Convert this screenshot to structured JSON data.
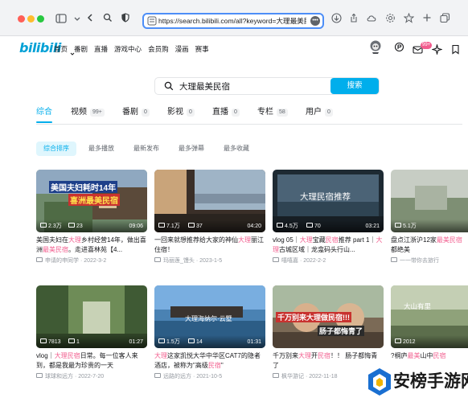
{
  "browser": {
    "url": "https://search.bilibili.com/all?keyword=大理最美民宿"
  },
  "site": {
    "logo": "bilibili",
    "nav": [
      "首页",
      "番剧",
      "直播",
      "游戏中心",
      "会员购",
      "漫画",
      "赛事"
    ],
    "message_badge": "99+"
  },
  "search": {
    "query": "大理最美民宿",
    "button": "搜索"
  },
  "tabs": [
    {
      "label": "综合",
      "count": ""
    },
    {
      "label": "视频",
      "count": "99+"
    },
    {
      "label": "番剧",
      "count": "0"
    },
    {
      "label": "影视",
      "count": "0"
    },
    {
      "label": "直播",
      "count": "0"
    },
    {
      "label": "专栏",
      "count": "58"
    },
    {
      "label": "用户",
      "count": "0"
    }
  ],
  "filters": [
    "综合排序",
    "最多播放",
    "最新发布",
    "最多弹幕",
    "最多收藏"
  ],
  "colors": {
    "accent": "#00aeec",
    "highlight": "#f25d8e",
    "brand": "#00a1d6"
  },
  "videos": [
    {
      "thumb_text": [
        "美国夫妇耗时14年",
        "喜洲最美民宿"
      ],
      "plays": "2.3万",
      "danmaku": "23",
      "duration": "09:06",
      "title": [
        [
          "美国夫妇在",
          ""
        ],
        [
          "大理",
          "hl"
        ],
        [
          "乡村经营14年，做出喜洲",
          ""
        ],
        [
          "最美民宿",
          "hl"
        ],
        [
          "。走进喜林苑【4...",
          ""
        ]
      ],
      "author": "申请的申同学",
      "date": "2022-3-2"
    },
    {
      "thumb_text": [],
      "plays": "7.1万",
      "danmaku": "37",
      "duration": "04:20",
      "title": [
        [
          "一回来就想推荐给大家的神仙",
          ""
        ],
        [
          "大理",
          "hl"
        ],
        [
          "丽江住宿！",
          ""
        ]
      ],
      "author": "玛丽莲_馒头",
      "date": "2023-1-5"
    },
    {
      "thumb_text": [
        "大理民宿推荐"
      ],
      "plays": "4.5万",
      "danmaku": "70",
      "duration": "03:21",
      "title": [
        [
          "vlog 05｜",
          ""
        ],
        [
          "大理",
          "hl"
        ],
        [
          "宝藏",
          ""
        ],
        [
          "民宿",
          "hl"
        ],
        [
          "推荐 part 1｜",
          ""
        ],
        [
          "大理",
          "hl"
        ],
        [
          "古城区域｜龙龛码头行山...",
          ""
        ]
      ],
      "author": "嘻嘻嘉",
      "date": "2022-2-2"
    },
    {
      "thumb_text": [],
      "plays": "5.1万",
      "danmaku": "",
      "duration": "",
      "title": [
        [
          "盘点江浙沪12家",
          ""
        ],
        [
          "最美民宿",
          "hl"
        ],
        [
          "都绝美",
          ""
        ]
      ],
      "author": "一一带你去旅行",
      "date": ""
    },
    {
      "thumb_text": [],
      "plays": "7813",
      "danmaku": "1",
      "duration": "01:27",
      "title": [
        [
          "vlog｜",
          ""
        ],
        [
          "大理",
          "hl"
        ],
        [
          "民宿",
          "hl"
        ],
        [
          "日常。每一位客人来到，都是我最为珍贵的一天",
          ""
        ]
      ],
      "author": "球球和远方",
      "date": "2022-7-20"
    },
    {
      "thumb_text": [
        "大理海纳尔·云墅"
      ],
      "plays": "1.5万",
      "danmaku": "14",
      "duration": "01:31",
      "title": [
        [
          "大理",
          "hl"
        ],
        [
          "这家凯悦大华中华区CAT7的隐者酒店，被称为\"高级",
          ""
        ],
        [
          "民宿",
          "hl"
        ],
        [
          "\"",
          ""
        ]
      ],
      "author": "远路的远方",
      "date": "2021-10-5"
    },
    {
      "thumb_text": [
        "千万别来大理做民宿!!!",
        "肠子都悔青了"
      ],
      "plays": "",
      "danmaku": "",
      "duration": "",
      "title": [
        [
          "千万别来",
          ""
        ],
        [
          "大理",
          "hl"
        ],
        [
          "开",
          ""
        ],
        [
          "民宿",
          "hl"
        ],
        [
          "！！ 肠子都悔青了",
          ""
        ]
      ],
      "author": "枫华游记",
      "date": "2022-11-18"
    },
    {
      "thumb_text": [
        "大山有里"
      ],
      "plays": "2012",
      "danmaku": "",
      "duration": "",
      "title": [
        [
          "?桐庐",
          ""
        ],
        [
          "最美",
          "hl"
        ],
        [
          "山中",
          ""
        ],
        [
          "民宿",
          "hl"
        ],
        [
          "",
          ""
        ]
      ],
      "author": "",
      "date": ""
    }
  ],
  "watermark": "安榜手游网"
}
